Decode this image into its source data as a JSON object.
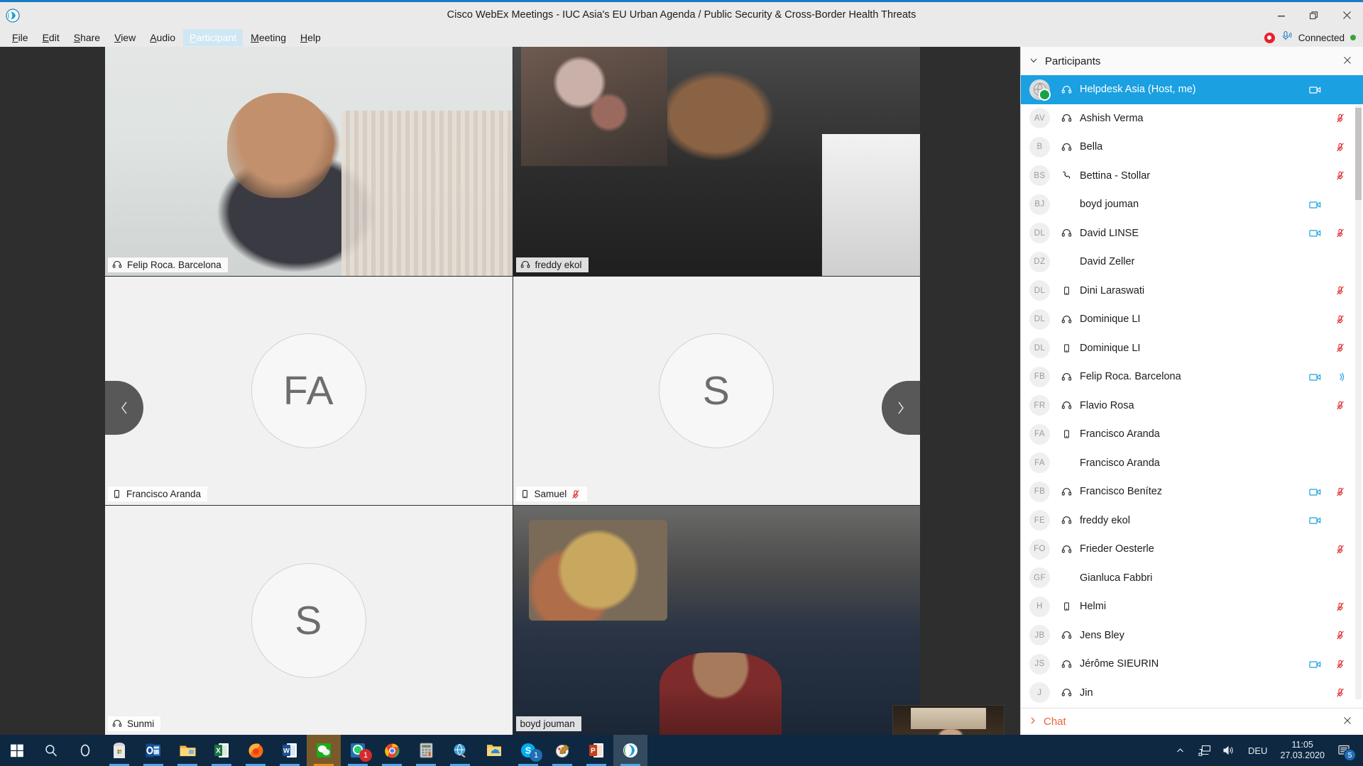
{
  "window": {
    "app_logo": "webex-logo",
    "title": "Cisco WebEx Meetings - IUC Asia's EU Urban Agenda / Public Security & Cross-Border Health Threats",
    "controls": {
      "minimize": "minimize-icon",
      "restore": "restore-icon",
      "close": "close-icon"
    }
  },
  "menubar": {
    "items": [
      {
        "label": "File",
        "accel": "F",
        "active": false
      },
      {
        "label": "Edit",
        "accel": "E",
        "active": false
      },
      {
        "label": "Share",
        "accel": "S",
        "active": false
      },
      {
        "label": "View",
        "accel": "V",
        "active": false
      },
      {
        "label": "Audio",
        "accel": "A",
        "active": false
      },
      {
        "label": "Participant",
        "accel": "P",
        "active": true
      },
      {
        "label": "Meeting",
        "accel": "M",
        "active": false
      },
      {
        "label": "Help",
        "accel": "H",
        "active": false
      }
    ],
    "status": {
      "recording_icon": "record-icon",
      "audio_icon": "microphone-icon",
      "connection_label": "Connected",
      "connection_color": "#3aa33a"
    }
  },
  "stage": {
    "nav_prev": "chevron-left-icon",
    "nav_next": "chevron-right-icon",
    "tiles": [
      {
        "name": "Felip Roca. Barcelona",
        "kind": "video",
        "media_icon": "headset-icon",
        "active": true,
        "muted": false,
        "initials": ""
      },
      {
        "name": "freddy ekol",
        "kind": "video",
        "media_icon": "headset-icon",
        "active": false,
        "muted": false,
        "initials": ""
      },
      {
        "name": "Francisco Aranda",
        "kind": "avatar",
        "media_icon": "mobile-icon",
        "active": false,
        "muted": false,
        "initials": "FA"
      },
      {
        "name": "Samuel",
        "kind": "avatar",
        "media_icon": "mobile-icon",
        "active": false,
        "muted": true,
        "initials": "S"
      },
      {
        "name": "Sunmi",
        "kind": "avatar",
        "media_icon": "headset-icon",
        "active": false,
        "muted": false,
        "initials": "S"
      },
      {
        "name": "boyd jouman",
        "kind": "video",
        "media_icon": "none",
        "active": false,
        "muted": false,
        "initials": ""
      }
    ],
    "selfview": {
      "label": "self-view-thumbnail"
    }
  },
  "participants_panel": {
    "title": "Participants",
    "collapse_icon": "chevron-down-icon",
    "close_icon": "close-icon",
    "list": [
      {
        "initials": "",
        "name": "Helpdesk Asia  (Host, me)",
        "media": "headset-icon",
        "video": true,
        "muted": false,
        "speaking": false,
        "selected": true,
        "avatar": "globe"
      },
      {
        "initials": "AV",
        "name": "Ashish Verma",
        "media": "headset-icon",
        "video": false,
        "muted": true,
        "speaking": false,
        "selected": false
      },
      {
        "initials": "B",
        "name": "Bella",
        "media": "headset-icon",
        "video": false,
        "muted": true,
        "speaking": false,
        "selected": false
      },
      {
        "initials": "BS",
        "name": "Bettina - Stollar",
        "media": "phone-icon",
        "video": false,
        "muted": true,
        "speaking": false,
        "selected": false
      },
      {
        "initials": "BJ",
        "name": "boyd jouman",
        "media": "none",
        "video": true,
        "muted": false,
        "speaking": false,
        "selected": false
      },
      {
        "initials": "DL",
        "name": "David LINSE",
        "media": "headset-icon",
        "video": true,
        "muted": true,
        "speaking": false,
        "selected": false
      },
      {
        "initials": "DZ",
        "name": "David Zeller",
        "media": "none",
        "video": false,
        "muted": false,
        "speaking": false,
        "selected": false
      },
      {
        "initials": "DL",
        "name": "Dini Laraswati",
        "media": "mobile-icon",
        "video": false,
        "muted": true,
        "speaking": false,
        "selected": false
      },
      {
        "initials": "DL",
        "name": "Dominique LI",
        "media": "headset-icon",
        "video": false,
        "muted": true,
        "speaking": false,
        "selected": false
      },
      {
        "initials": "DL",
        "name": "Dominique LI",
        "media": "mobile-icon",
        "video": false,
        "muted": true,
        "speaking": false,
        "selected": false
      },
      {
        "initials": "FB",
        "name": "Felip Roca. Barcelona",
        "media": "headset-icon",
        "video": true,
        "muted": false,
        "speaking": true,
        "selected": false
      },
      {
        "initials": "FR",
        "name": "Flavio Rosa",
        "media": "headset-icon",
        "video": false,
        "muted": true,
        "speaking": false,
        "selected": false
      },
      {
        "initials": "FA",
        "name": "Francisco Aranda",
        "media": "mobile-icon",
        "video": false,
        "muted": false,
        "speaking": false,
        "selected": false
      },
      {
        "initials": "FA",
        "name": "Francisco Aranda",
        "media": "none",
        "video": false,
        "muted": false,
        "speaking": false,
        "selected": false
      },
      {
        "initials": "FB",
        "name": "Francisco Benítez",
        "media": "headset-icon",
        "video": true,
        "muted": true,
        "speaking": false,
        "selected": false
      },
      {
        "initials": "FE",
        "name": "freddy ekol",
        "media": "headset-icon",
        "video": true,
        "muted": false,
        "speaking": false,
        "selected": false
      },
      {
        "initials": "FO",
        "name": "Frieder Oesterle",
        "media": "headset-icon",
        "video": false,
        "muted": true,
        "speaking": false,
        "selected": false
      },
      {
        "initials": "GF",
        "name": "Gianluca Fabbri",
        "media": "none",
        "video": false,
        "muted": false,
        "speaking": false,
        "selected": false
      },
      {
        "initials": "H",
        "name": "Helmi",
        "media": "mobile-icon",
        "video": false,
        "muted": true,
        "speaking": false,
        "selected": false
      },
      {
        "initials": "JB",
        "name": "Jens Bley",
        "media": "headset-icon",
        "video": false,
        "muted": true,
        "speaking": false,
        "selected": false
      },
      {
        "initials": "JS",
        "name": "Jérôme SIEURIN",
        "media": "headset-icon",
        "video": true,
        "muted": true,
        "speaking": false,
        "selected": false
      },
      {
        "initials": "J",
        "name": "Jin",
        "media": "headset-icon",
        "video": false,
        "muted": true,
        "speaking": false,
        "selected": false
      }
    ]
  },
  "chat_panel": {
    "title": "Chat",
    "expand_icon": "chevron-right-icon",
    "close_icon": "close-icon"
  },
  "taskbar": {
    "items": [
      {
        "name": "start-button",
        "label": "Start",
        "state": "normal"
      },
      {
        "name": "search-button",
        "label": "Search",
        "state": "normal"
      },
      {
        "name": "cortana-button",
        "label": "Cortana",
        "state": "normal"
      },
      {
        "name": "microsoft-store",
        "label": "Microsoft Store",
        "state": "open"
      },
      {
        "name": "outlook",
        "label": "Outlook",
        "state": "open"
      },
      {
        "name": "file-explorer",
        "label": "File Explorer",
        "state": "open"
      },
      {
        "name": "excel",
        "label": "Excel",
        "state": "open"
      },
      {
        "name": "firefox",
        "label": "Firefox",
        "state": "open"
      },
      {
        "name": "word",
        "label": "Word",
        "state": "open"
      },
      {
        "name": "wechat",
        "label": "WeChat",
        "state": "active"
      },
      {
        "name": "whatsapp",
        "label": "WhatsApp",
        "state": "open",
        "badge": "1"
      },
      {
        "name": "chrome",
        "label": "Chrome",
        "state": "open"
      },
      {
        "name": "calculator-app",
        "label": "Calculator",
        "state": "open"
      },
      {
        "name": "globe-app",
        "label": "Browser",
        "state": "open"
      },
      {
        "name": "onedrive-folder",
        "label": "OneDrive",
        "state": "normal"
      },
      {
        "name": "skype",
        "label": "Skype",
        "state": "open",
        "badge": "1"
      },
      {
        "name": "paint",
        "label": "Paint",
        "state": "open"
      },
      {
        "name": "powerpoint",
        "label": "PowerPoint",
        "state": "open"
      },
      {
        "name": "webex",
        "label": "Cisco WebEx",
        "state": "focused"
      }
    ],
    "tray": {
      "overflow_icon": "chevron-up-icon",
      "network_icon": "network-icon",
      "volume_icon": "volume-icon",
      "language": "DEU",
      "time": "11:05",
      "date": "27.03.2020",
      "action_center_icon": "action-center-icon",
      "notification_count": "5"
    }
  }
}
